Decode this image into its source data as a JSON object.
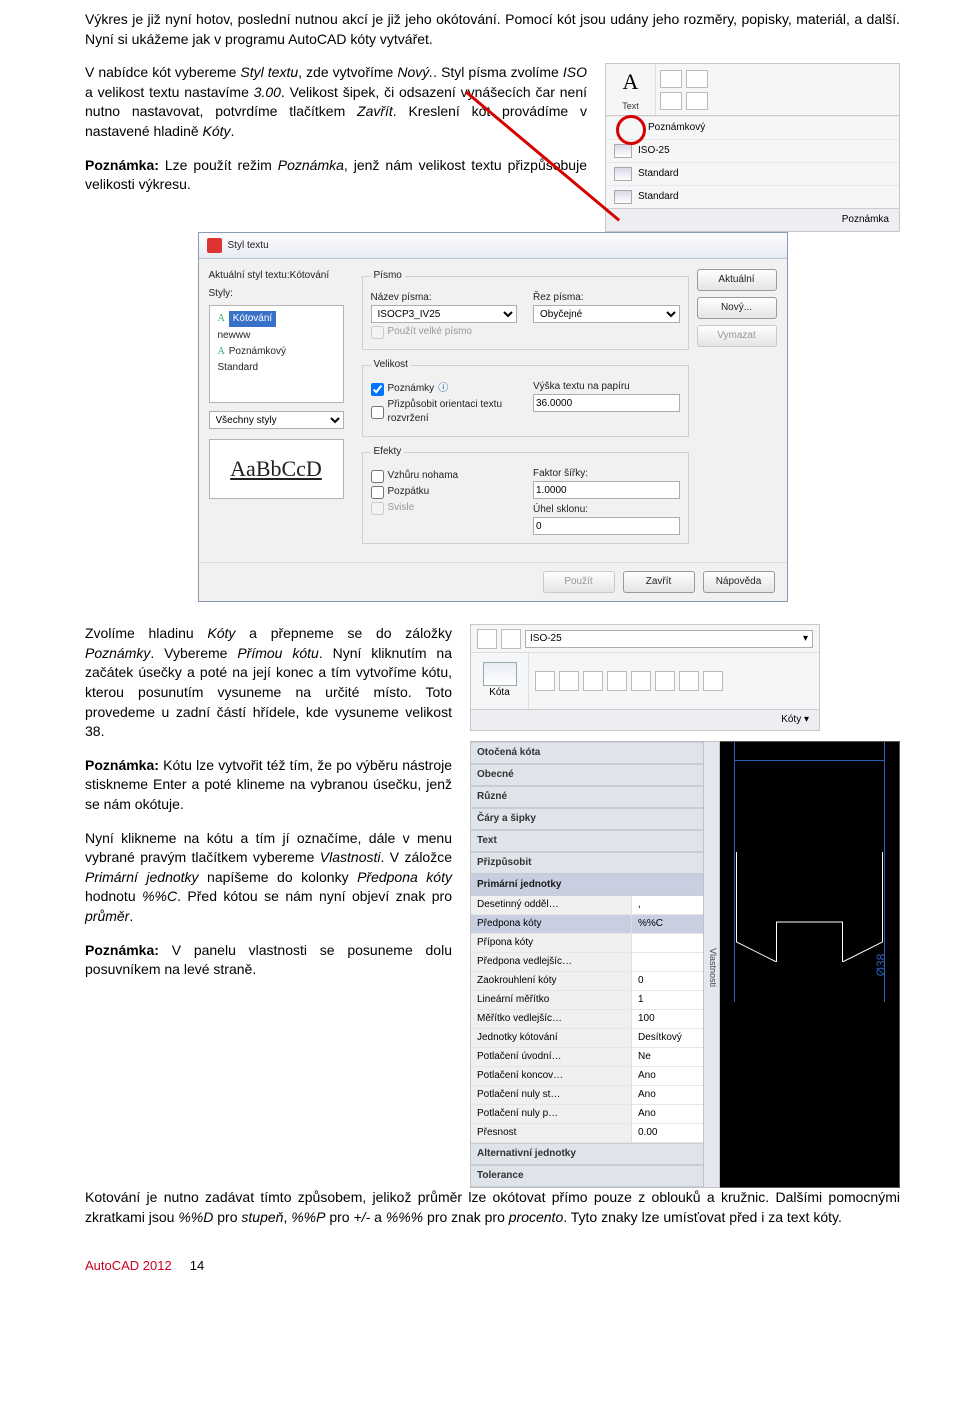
{
  "intro": "Výkres je již nyní hotov, poslední nutnou akcí je již jeho okótování. Pomocí kót jsou udány jeho rozměry, popisky, materiál, a další. Nyní si ukážeme jak v programu AutoCAD kóty vytvářet.",
  "p2a": "V nabídce kót vybereme ",
  "p2b": "Styl textu",
  "p2c": ", zde vytvoříme ",
  "p2d": "Nový.",
  "p2e": ". Styl písma zvolíme ",
  "p2f": "ISO",
  "p2g": " a velikost textu nastavíme ",
  "p2h": "3.00",
  "p2i": ". Velikost šipek, či odsazení vynášecích čar není nutno nastavovat, potvrdíme tlačítkem ",
  "p2j": "Zavřít",
  "p2k": ". Kreslení kót provádíme v nastavené hladině ",
  "p2l": "Kóty",
  "p2m": ".",
  "note1a": "Poznámka:",
  "note1b": " Lze použít režim ",
  "note1c": "Poznámka",
  "note1d": ", jenž nám velikost textu přizpůsobuje velikosti výkresu.",
  "ribbon1": {
    "textLabel": "Text",
    "rows": [
      "Poznámkový",
      "ISO-25",
      "Standard",
      "Standard"
    ],
    "footer": "Poznámka"
  },
  "dlg": {
    "title": "Styl textu",
    "curLabel": "Aktuální styl textu:Kótování",
    "stylyLabel": "Styly:",
    "styles": [
      "Kótování",
      "newww",
      "Poznámkový",
      "Standard"
    ],
    "allStyles": "Všechny styly",
    "preview": "AaBbCcD",
    "grpPismo": "Písmo",
    "nazevPisma": "Název písma:",
    "fontValue": "ISOCP3_IV25",
    "rezPisma": "Řez písma:",
    "rezValue": "Obyčejné",
    "bigFont": "Použít velké písmo",
    "grpVelikost": "Velikost",
    "chkPozn": "Poznámky",
    "chkOrient": "Přizpůsobit orientaci textu rozvržení",
    "vyskaLabel": "Výška textu na papíru",
    "vyskaVal": "36.0000",
    "grpEfekty": "Efekty",
    "chkVzhuru": "Vzhůru nohama",
    "chkPozp": "Pozpátku",
    "chkSvisle": "Svisle",
    "faktorLabel": "Faktor šířky:",
    "faktorVal": "1.0000",
    "uhelLabel": "Úhel sklonu:",
    "uhelVal": "0",
    "btnAkt": "Aktuální",
    "btnNovy": "Nový...",
    "btnVymaz": "Vymazat",
    "btnPouzit": "Použít",
    "btnZavrit": "Zavřít",
    "btnNapov": "Nápověda"
  },
  "p3a": "Zvolíme hladinu ",
  "p3b": "Kóty",
  "p3c": " a přepneme se do záložky ",
  "p3d": "Poznámky",
  "p3e": ". Vybereme ",
  "p3f": "Přímou kótu",
  "p3g": ". Nyní kliknutím na začátek úsečky a poté na její konec a tím vytvoříme kótu, kterou posunutím vysuneme na určité místo. Toto provedeme u zadní částí hřídele, kde vysuneme velikost 38.",
  "note2a": "Poznámka:",
  "note2b": " Kótu lze vytvořit též tím, že po výběru nástroje stiskneme Enter a poté klineme na vybranou úsečku, jenž se nám okótuje.",
  "p4a": "Nyní klikneme na kótu a tím jí označíme, dále v menu vybrané pravým tlačítkem vybereme ",
  "p4b": "Vlastnosti",
  "p4c": ". V záložce ",
  "p4d": "Primární jednotky",
  "p4e": " napíšeme do kolonky ",
  "p4f": "Předpona kóty",
  "p4g": " hodnotu ",
  "p4h": "%%C",
  "p4i": ". Před kótou se nám nyní objeví znak pro ",
  "p4j": "průměr",
  "p4k": ".",
  "note3a": "Poznámka:",
  "note3b": " V panelu vlastnosti se posuneme dolu posuvníkem na levé straně.",
  "ribbon3": {
    "dd": "ISO-25",
    "kota": "Kóta",
    "footer": "Kóty ▾"
  },
  "props": {
    "tab": "Vlastnosti",
    "rows": [
      {
        "g": "Otočená kóta"
      },
      {
        "g": "Obecné"
      },
      {
        "g": "Různé"
      },
      {
        "g": "Čáry a šipky"
      },
      {
        "g": "Text"
      },
      {
        "g": "Přizpůsobit"
      },
      {
        "g": "Primární jednotky",
        "hl": true
      },
      {
        "k": "Desetinný odděl…",
        "v": ","
      },
      {
        "k": "Předpona kóty",
        "v": "%%C",
        "hl": true
      },
      {
        "k": "Přípona kóty",
        "v": ""
      },
      {
        "k": "Předpona vedlejšíc…",
        "v": ""
      },
      {
        "k": "Zaokrouhlení kóty",
        "v": "0"
      },
      {
        "k": "Lineární měřítko",
        "v": "1"
      },
      {
        "k": "Měřítko vedlejšíc…",
        "v": "100"
      },
      {
        "k": "Jednotky kótování",
        "v": "Desítkový"
      },
      {
        "k": "Potlačení úvodní…",
        "v": "Ne"
      },
      {
        "k": "Potlačení koncov…",
        "v": "Ano"
      },
      {
        "k": "Potlačení nuly st…",
        "v": "Ano"
      },
      {
        "k": "Potlačení nuly p…",
        "v": "Ano"
      },
      {
        "k": "Přesnost",
        "v": "0.00"
      },
      {
        "g": "Alternativní jednotky"
      },
      {
        "g": "Tolerance"
      }
    ],
    "o38": "Ø38"
  },
  "p5a": "Kotování je nutno zadávat tímto způsobem, jelikož průměr lze okótovat přímo pouze z oblouků a kružnic. Dalšími pomocnými zkratkami jsou ",
  "p5b": "%%D",
  "p5c": " pro ",
  "p5d": "stupeň",
  "p5e": ", ",
  "p5f": "%%P",
  "p5g": " pro ",
  "p5h": "+/-",
  "p5i": " a ",
  "p5j": "%%%",
  "p5k": " pro znak pro ",
  "p5l": "procento",
  "p5m": ". Tyto znaky lze umísťovat před i za text kóty.",
  "footer": {
    "product": "AutoCAD 2012",
    "page": "14"
  }
}
